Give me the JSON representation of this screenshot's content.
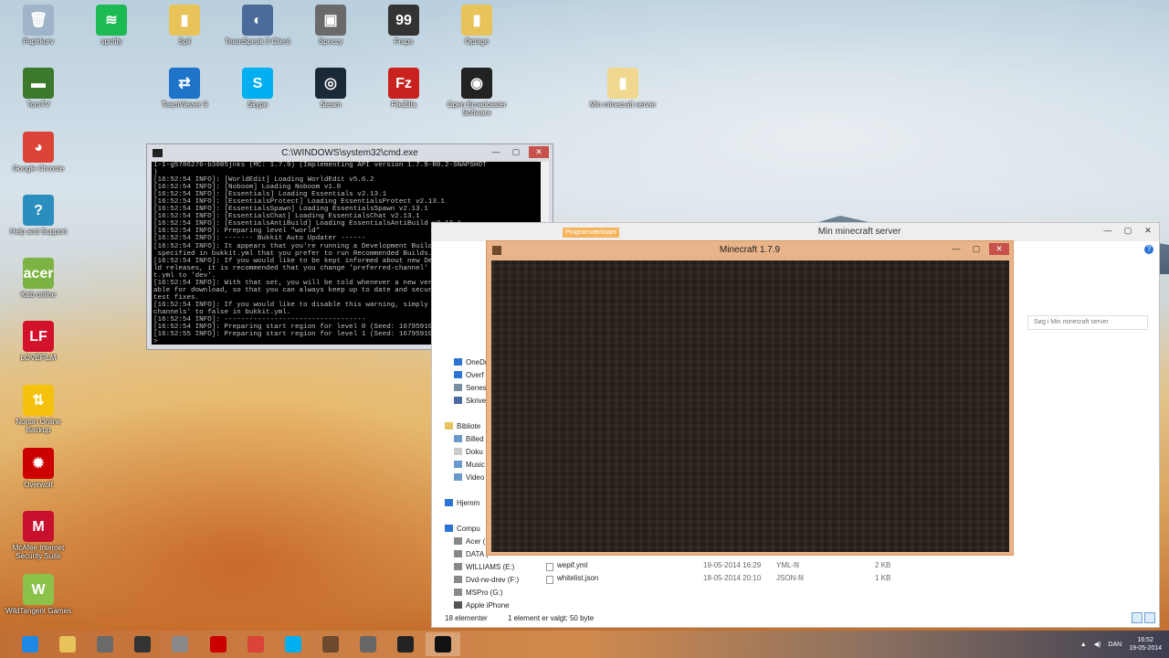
{
  "desktop_icons": [
    {
      "label": "Papirkurv",
      "icon": "recycle-bin-icon",
      "color": "#9fb4c8",
      "glyph": "🗑"
    },
    {
      "label": "spotify",
      "icon": "spotify-icon",
      "color": "#1db954",
      "glyph": "≋"
    },
    {
      "label": "Spil",
      "icon": "folder-icon",
      "color": "#e8c35a",
      "glyph": "▮"
    },
    {
      "label": "TeamSpeak 3 Client",
      "icon": "teamspeak-icon",
      "color": "#4a6a9a",
      "glyph": "◐"
    },
    {
      "label": "Speccy",
      "icon": "speccy-icon",
      "color": "#6a6a6a",
      "glyph": "▣"
    },
    {
      "label": "Fraps",
      "icon": "fraps-icon",
      "color": "#333",
      "glyph": "99"
    },
    {
      "label": "Optage",
      "icon": "folder-icon",
      "color": "#e8c35a",
      "glyph": "▮"
    },
    {
      "label": "TomTV",
      "icon": "tomtv-icon",
      "color": "#3a7a2a",
      "glyph": "▬"
    },
    {
      "label": "TeamViewer 9",
      "icon": "teamviewer-icon",
      "color": "#1d74c9",
      "glyph": "⇄"
    },
    {
      "label": "Skype",
      "icon": "skype-icon",
      "color": "#00aff0",
      "glyph": "S"
    },
    {
      "label": "Steam",
      "icon": "steam-icon",
      "color": "#1b2838",
      "glyph": "◎"
    },
    {
      "label": "FileZilla",
      "icon": "filezilla-icon",
      "color": "#c9211e",
      "glyph": "Fz"
    },
    {
      "label": "Open Broadcaster Software",
      "icon": "obs-icon",
      "color": "#222",
      "glyph": "◉"
    },
    {
      "label": "Min minecraft server",
      "icon": "folder-icon",
      "color": "#f0d890",
      "glyph": "▮"
    },
    {
      "label": "Google Chrome",
      "icon": "chrome-icon",
      "color": "#db4437",
      "glyph": "◕"
    },
    {
      "label": "Help and Support",
      "icon": "help-icon",
      "color": "#2a8fbf",
      "glyph": "?"
    },
    {
      "label": "Køb online",
      "icon": "acer-icon",
      "color": "#7cb342",
      "glyph": "acer"
    },
    {
      "label": "LOVEFiLM",
      "icon": "lovefilm-icon",
      "color": "#d3122b",
      "glyph": "LF"
    },
    {
      "label": "Norton Online Backup",
      "icon": "norton-icon",
      "color": "#f4c20d",
      "glyph": "⇅"
    },
    {
      "label": "Overwolf",
      "icon": "overwolf-icon",
      "color": "#c00",
      "glyph": "✹"
    },
    {
      "label": "McAfee Internet Security Suite",
      "icon": "mcafee-icon",
      "color": "#c8102e",
      "glyph": "M"
    },
    {
      "label": "WildTangent Games",
      "icon": "wildtangent-icon",
      "color": "#8bc34a",
      "glyph": "W"
    }
  ],
  "cmd": {
    "title": "C:\\WINDOWS\\system32\\cmd.exe",
    "lines": [
      "1-1-g5786276-b3085jnks (MC: 1.7.9) (Implementing API version 1.7.9-R0.2-SNAPSHOT",
      ")",
      "[16:52:54 INFO]: [WorldEdit] Loading WorldEdit v5.6.2",
      "[16:52:54 INFO]: [Noboom] Loading Noboom v1.0",
      "[16:52:54 INFO]: [Essentials] Loading Essentials v2.13.1",
      "[16:52:54 INFO]: [EssentialsProtect] Loading EssentialsProtect v2.13.1",
      "[16:52:54 INFO]: [EssentialsSpawn] Loading EssentialsSpawn v2.13.1",
      "[16:52:54 INFO]: [EssentialsChat] Loading EssentialsChat v2.13.1",
      "[16:52:54 INFO]: [EssentialsAntiBuild] Loading EssentialsAntiBuild v2.13.1",
      "[16:52:54 INFO]: Preparing level \"world\"",
      "[16:52:54 INFO]: ------- Bukkit Auto Updater ------",
      "[16:52:54 INFO]: It appears that you're running a Development Build,",
      " specified in bukkit.yml that you prefer to run Recommended Builds.",
      "[16:52:54 INFO]: If you would like to be kept informed about new Deve",
      "ld releases, it is recommended that you change 'preferred-channel' in",
      "t.yml to 'dev'.",
      "[16:52:54 INFO]: With that set, you will be told whenever a new versi",
      "able for download, so that you can always keep up to date and secure",
      "test fixes.",
      "[16:52:54 INFO]: If you would like to disable this warning, simply se",
      "channels' to false in bukkit.yml.",
      "[16:52:54 INFO]: ----------------------------------",
      "[16:52:54 INFO]: Preparing start region for level 0 (Seed: 16795910423",
      "[16:52:55 INFO]: Preparing start region for level 1 (Seed: 16795910423",
      ">"
    ]
  },
  "explorer": {
    "ribbon_tab": "Programværktøjer",
    "title": "Min minecraft server",
    "search_placeholder": "Søg i Min minecraft server",
    "nav": [
      {
        "label": "OneDr",
        "color": "#2b74d4"
      },
      {
        "label": "Overf",
        "color": "#2b74d4"
      },
      {
        "label": "Senes",
        "color": "#7a8ea2"
      },
      {
        "label": "Skrive",
        "color": "#4a6aa0"
      },
      {
        "label": "",
        "color": "transparent"
      },
      {
        "label": "Bibliote",
        "color": "#e8c35a"
      },
      {
        "label": "Billed",
        "color": "#6a9acb"
      },
      {
        "label": "Doku",
        "color": "#ccc"
      },
      {
        "label": "Music",
        "color": "#6a9acb"
      },
      {
        "label": "Video",
        "color": "#6a9acb"
      },
      {
        "label": "",
        "color": "transparent"
      },
      {
        "label": "Hjemm",
        "color": "#2b74d4"
      },
      {
        "label": "",
        "color": "transparent"
      },
      {
        "label": "Compu",
        "color": "#2b74d4"
      },
      {
        "label": "Acer (",
        "color": "#888"
      },
      {
        "label": "DATA (",
        "color": "#888"
      },
      {
        "label": "WILLIAMS (E:)",
        "color": "#888"
      },
      {
        "label": "Dvd-rw-drev (F:)",
        "color": "#888"
      },
      {
        "label": "MSPro (G:)",
        "color": "#888"
      },
      {
        "label": "Apple iPhone",
        "color": "#555"
      }
    ],
    "files": [
      {
        "name": "wepif.yml",
        "date": "19-05-2014 16:29",
        "type": "YML-fil",
        "size": "2 KB"
      },
      {
        "name": "whitelist.json",
        "date": "18-05-2014 20:10",
        "type": "JSON-fil",
        "size": "1 KB"
      }
    ],
    "status_items": "18 elementer",
    "status_selected": "1 element er valgt: 50 byte"
  },
  "minecraft": {
    "title": "Minecraft 1.7.9"
  },
  "taskbar": {
    "apps": [
      {
        "icon": "ie-icon",
        "color": "#1e88e5"
      },
      {
        "icon": "file-explorer-icon",
        "color": "#e8c35a"
      },
      {
        "icon": "teamviewer-icon",
        "color": "#6a6a6a"
      },
      {
        "icon": "obs-icon",
        "color": "#333"
      },
      {
        "icon": "speccy-icon",
        "color": "#888"
      },
      {
        "icon": "power-icon",
        "color": "#c00"
      },
      {
        "icon": "chrome-icon",
        "color": "#db4437"
      },
      {
        "icon": "skype-icon",
        "color": "#00aff0"
      },
      {
        "icon": "minecraft-icon",
        "color": "#6c4a2b"
      },
      {
        "icon": "tool-icon",
        "color": "#666"
      },
      {
        "icon": "obs-icon",
        "color": "#222"
      },
      {
        "icon": "cmd-icon",
        "color": "#111"
      }
    ],
    "language": "DAN",
    "time": "16:52",
    "date": "19-05-2014"
  }
}
